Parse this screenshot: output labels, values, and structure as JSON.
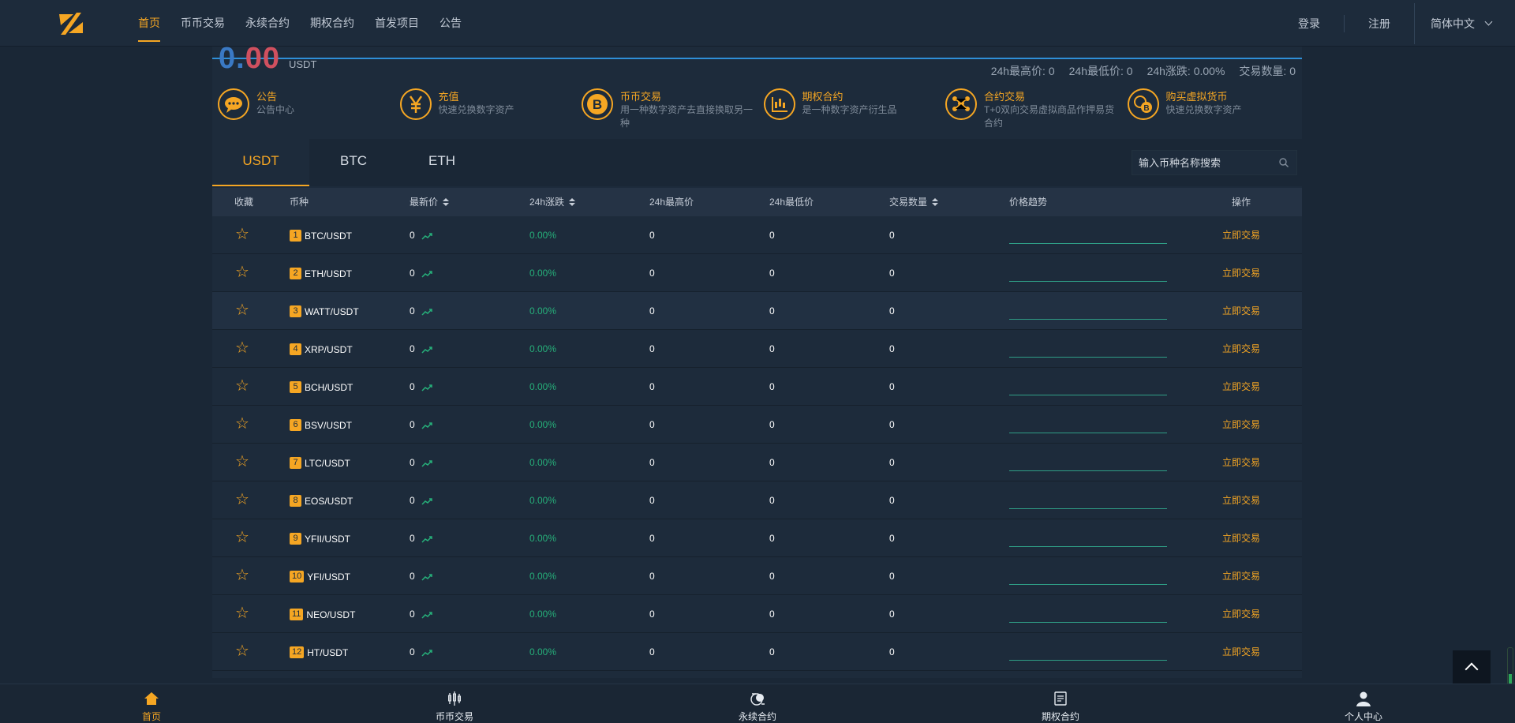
{
  "nav": {
    "links": [
      "首页",
      "币币交易",
      "永续合约",
      "期权合约",
      "首发项目",
      "公告"
    ],
    "active_index": 0,
    "login": "登录",
    "register": "注册",
    "language": "简体中文"
  },
  "ticker": {
    "price_blue": "0.",
    "price_red": "00",
    "unit": "USDT",
    "high_label": "24h最高价: 0",
    "low_label": "24h最低价: 0",
    "change_label": "24h涨跌: 0.00%",
    "volume_label": "交易数量: 0"
  },
  "features": [
    {
      "title": "公告",
      "desc": "公告中心",
      "icon": "chat-bubble-icon"
    },
    {
      "title": "充值",
      "desc": "快速兑换数字资产",
      "icon": "yen-icon"
    },
    {
      "title": "币币交易",
      "desc": "用一种数字资产去直接换取另一种",
      "icon": "bitcoin-icon"
    },
    {
      "title": "期权合约",
      "desc": "是一种数字资产衍生品",
      "icon": "candlestick-chart-icon"
    },
    {
      "title": "合约交易",
      "desc": "T+0双向交易虚拟商品作押易货合约",
      "icon": "network-nodes-icon"
    },
    {
      "title": "购买虚拟货币",
      "desc": "快速兑换数字资产",
      "icon": "coin-exchange-icon"
    }
  ],
  "tabs": [
    "USDT",
    "BTC",
    "ETH"
  ],
  "active_tab": 0,
  "search": {
    "placeholder": "输入币种名称搜索"
  },
  "table": {
    "headers": {
      "fav": "收藏",
      "coin": "币种",
      "last": "最新价",
      "change": "24h涨跌",
      "high": "24h最高价",
      "low": "24h最低价",
      "volume": "交易数量",
      "trend": "价格趋势",
      "action": "操作"
    },
    "rows": [
      {
        "rank": "1",
        "pair": "BTC/USDT",
        "last": "0",
        "change": "0.00%",
        "high": "0",
        "low": "0",
        "volume": "0",
        "action": "立即交易"
      },
      {
        "rank": "2",
        "pair": "ETH/USDT",
        "last": "0",
        "change": "0.00%",
        "high": "0",
        "low": "0",
        "volume": "0",
        "action": "立即交易"
      },
      {
        "rank": "3",
        "pair": "WATT/USDT",
        "last": "0",
        "change": "0.00%",
        "high": "0",
        "low": "0",
        "volume": "0",
        "action": "立即交易"
      },
      {
        "rank": "4",
        "pair": "XRP/USDT",
        "last": "0",
        "change": "0.00%",
        "high": "0",
        "low": "0",
        "volume": "0",
        "action": "立即交易"
      },
      {
        "rank": "5",
        "pair": "BCH/USDT",
        "last": "0",
        "change": "0.00%",
        "high": "0",
        "low": "0",
        "volume": "0",
        "action": "立即交易"
      },
      {
        "rank": "6",
        "pair": "BSV/USDT",
        "last": "0",
        "change": "0.00%",
        "high": "0",
        "low": "0",
        "volume": "0",
        "action": "立即交易"
      },
      {
        "rank": "7",
        "pair": "LTC/USDT",
        "last": "0",
        "change": "0.00%",
        "high": "0",
        "low": "0",
        "volume": "0",
        "action": "立即交易"
      },
      {
        "rank": "8",
        "pair": "EOS/USDT",
        "last": "0",
        "change": "0.00%",
        "high": "0",
        "low": "0",
        "volume": "0",
        "action": "立即交易"
      },
      {
        "rank": "9",
        "pair": "YFII/USDT",
        "last": "0",
        "change": "0.00%",
        "high": "0",
        "low": "0",
        "volume": "0",
        "action": "立即交易"
      },
      {
        "rank": "10",
        "pair": "YFI/USDT",
        "last": "0",
        "change": "0.00%",
        "high": "0",
        "low": "0",
        "volume": "0",
        "action": "立即交易"
      },
      {
        "rank": "11",
        "pair": "NEO/USDT",
        "last": "0",
        "change": "0.00%",
        "high": "0",
        "low": "0",
        "volume": "0",
        "action": "立即交易"
      },
      {
        "rank": "12",
        "pair": "HT/USDT",
        "last": "0",
        "change": "0.00%",
        "high": "0",
        "low": "0",
        "volume": "0",
        "action": "立即交易"
      }
    ]
  },
  "bottom_nav": [
    {
      "label": "首页",
      "icon": "home-icon"
    },
    {
      "label": "币币交易",
      "icon": "candlestick-icon"
    },
    {
      "label": "永续合约",
      "icon": "coin-swap-icon"
    },
    {
      "label": "期权合约",
      "icon": "document-list-icon"
    },
    {
      "label": "个人中心",
      "icon": "user-icon"
    }
  ],
  "colors": {
    "accent": "#f5a623",
    "positive": "#26b07a",
    "background": "#1a2736",
    "panel": "#1d2b3b"
  }
}
